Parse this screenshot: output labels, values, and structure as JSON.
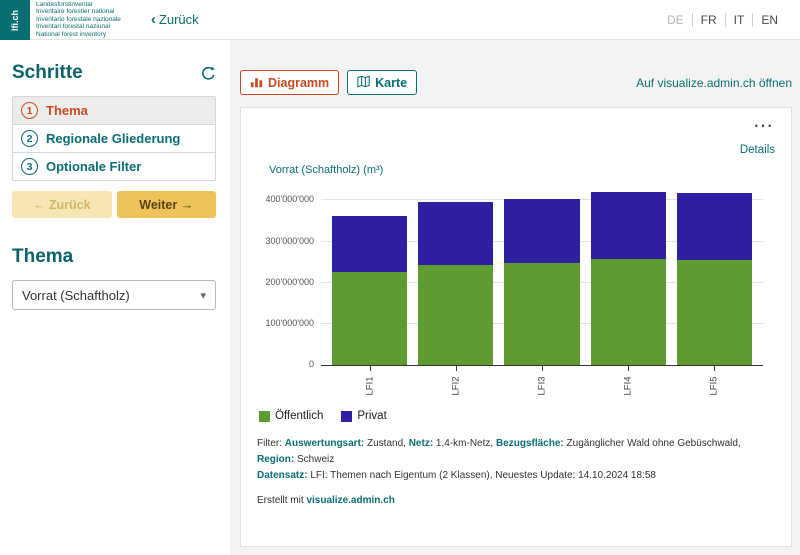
{
  "colors": {
    "teal": "#0b6e73",
    "red_accent": "#c64a22",
    "green_series": "#5e9c31",
    "navy_series": "#2d1fa0",
    "yellow_button": "#eec45a"
  },
  "icons": {
    "more_menu": "⋯",
    "chevron_down": "▾",
    "back_chevron": "‹"
  },
  "header": {
    "logo_text": "lfi.ch",
    "org_lines": [
      "Landesforstinventar",
      "Inventaire forestier national",
      "Inventario forestale nazionale",
      "Inventari forestal naziunal",
      "National forest inventory"
    ],
    "back_label": "Zurück",
    "langs": [
      "DE",
      "FR",
      "IT",
      "EN"
    ],
    "active_lang": "DE"
  },
  "sidebar": {
    "steps_title": "Schritte",
    "steps": [
      {
        "number": "1",
        "label": "Thema"
      },
      {
        "number": "2",
        "label": "Regionale Gliederung"
      },
      {
        "number": "3",
        "label": "Optionale Filter"
      }
    ],
    "back_button": "← Zurück",
    "next_button": "Weiter →",
    "thema_title": "Thema",
    "select_value": "Vorrat (Schaftholz)"
  },
  "main": {
    "diagram_button": "Diagramm",
    "map_button": "Karte",
    "open_link": "Auf visualize.admin.ch öffnen",
    "details_link": "Details"
  },
  "chart_data": {
    "type": "bar",
    "stacked": true,
    "ylabel": "Vorrat (Schaftholz) (m³)",
    "categories": [
      "LFI1",
      "LFI2",
      "LFI3",
      "LFI4",
      "LFI5"
    ],
    "series": [
      {
        "name": "Öffentlich",
        "color": "#5e9c31",
        "values": [
          226000000,
          244000000,
          248000000,
          257000000,
          255000000
        ]
      },
      {
        "name": "Privat",
        "color": "#2d1fa0",
        "values": [
          135000000,
          151000000,
          156000000,
          163000000,
          163000000
        ]
      }
    ],
    "ylim": [
      0,
      430000000
    ],
    "yticks": [
      0,
      100000000,
      200000000,
      300000000,
      400000000
    ],
    "ytick_labels": [
      "0",
      "100'000'000",
      "200'000'000",
      "300'000'000",
      "400'000'000"
    ],
    "grid": true,
    "legend_position": "bottom-left"
  },
  "footer": {
    "filter_line": [
      {
        "text": "Filter: ",
        "em": false
      },
      {
        "text": "Auswertungsart:",
        "em": true
      },
      {
        "text": " Zustand, ",
        "em": false
      },
      {
        "text": "Netz:",
        "em": true
      },
      {
        "text": " 1,4-km-Netz, ",
        "em": false
      },
      {
        "text": "Bezugsfläche:",
        "em": true
      },
      {
        "text": " Zugänglicher Wald ohne Gebüschwald, ",
        "em": false
      },
      {
        "text": "Region:",
        "em": true
      },
      {
        "text": " Schweiz",
        "em": false
      }
    ],
    "dataset_line": [
      {
        "text": "Datensatz:",
        "em": true
      },
      {
        "text": " LFI: Themen nach Eigentum (2 Klassen), Neuestes Update: 14.10.2024 18:58",
        "em": false
      }
    ],
    "created_line": [
      {
        "text": "Erstellt mit ",
        "em": false
      },
      {
        "text": "visualize.admin.ch",
        "em": true
      }
    ]
  }
}
